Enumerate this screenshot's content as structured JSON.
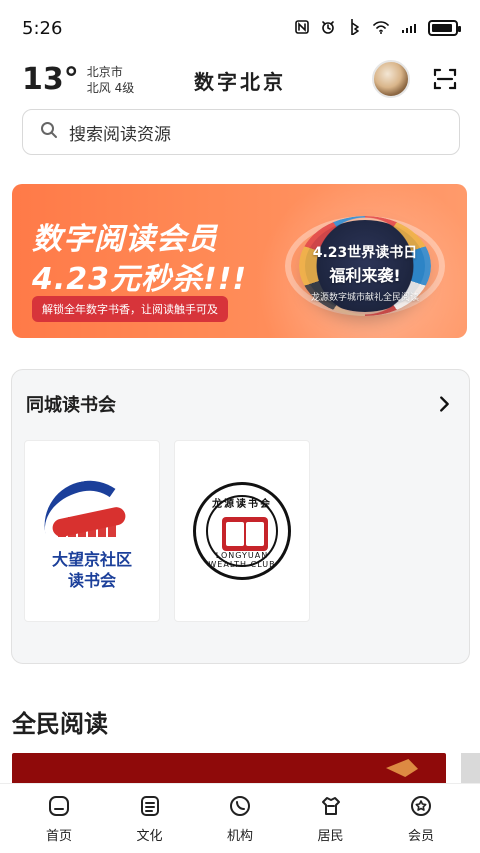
{
  "status_bar": {
    "time": "5:26",
    "icons": [
      "nfc-icon",
      "alarm-icon",
      "bluetooth-icon",
      "wifi-icon",
      "signal-icon",
      "battery-icon"
    ]
  },
  "header": {
    "temperature": "13°",
    "city": "北京市",
    "wind": "北风  4级",
    "brand_title": "数字北京"
  },
  "search": {
    "placeholder": "搜索阅读资源"
  },
  "banner": {
    "title": "数字阅读会员",
    "subtitle": "4.23元秒杀!!!",
    "tagline": "解锁全年数字书香，让阅读触手可及",
    "badge_line1": "4.23世界读书日",
    "badge_line2": "福利来袭!",
    "badge_line3": "龙源数字城市献礼全民阅读"
  },
  "club": {
    "title": "同城读书会",
    "tiles": [
      {
        "title_line1": "大望京社区",
        "title_line2": "读书会"
      },
      {
        "circle_text": "龙源读书会",
        "circle_bottom_text": "LONGYUAN WEALTH CLUB"
      }
    ]
  },
  "section": {
    "title": "全民阅读"
  },
  "bottom_nav": {
    "items": [
      {
        "label": "首页",
        "icon": "home-icon"
      },
      {
        "label": "文化",
        "icon": "document-icon"
      },
      {
        "label": "机构",
        "icon": "phone-icon"
      },
      {
        "label": "居民",
        "icon": "shirt-icon"
      },
      {
        "label": "会员",
        "icon": "member-icon"
      }
    ]
  }
}
